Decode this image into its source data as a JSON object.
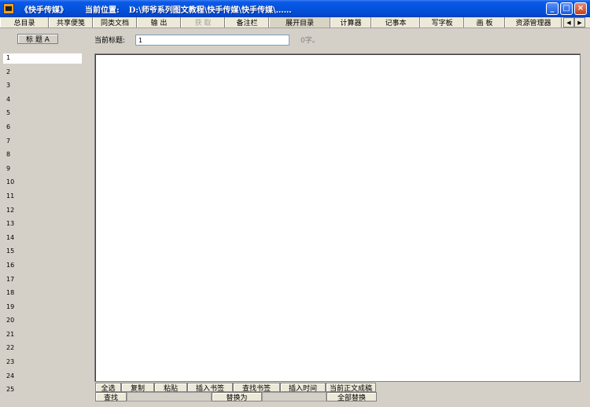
{
  "window": {
    "title": "《快手传媒》",
    "location_label": "当前位置:",
    "location_value": "D:\\师爷系列图文教程\\快手传媒\\快手传媒\\……"
  },
  "window_buttons": {
    "minimize": "_",
    "maximize": "□",
    "close": "×"
  },
  "menu": [
    {
      "label": "总目录",
      "enabled": true
    },
    {
      "label": "共享便笺",
      "enabled": true
    },
    {
      "label": "同类文档",
      "enabled": true
    },
    {
      "label": "输  出",
      "enabled": true
    },
    {
      "label": "获  取",
      "enabled": false
    },
    {
      "label": "备注栏",
      "enabled": true
    },
    {
      "label": "展开目录",
      "enabled": true
    },
    {
      "label": "计算器",
      "enabled": true
    },
    {
      "label": "记事本",
      "enabled": true
    },
    {
      "label": "写字板",
      "enabled": true
    },
    {
      "label": "画  板",
      "enabled": true
    },
    {
      "label": "资源管理器",
      "enabled": true
    }
  ],
  "menu_scroll": {
    "left": "◀",
    "right": "▶"
  },
  "title_list": {
    "header": "标 题 A",
    "items": [
      "1",
      "2",
      "3",
      "4",
      "5",
      "6",
      "7",
      "8",
      "9",
      "10",
      "11",
      "12",
      "13",
      "14",
      "15",
      "16",
      "17",
      "18",
      "19",
      "20",
      "21",
      "22",
      "23",
      "24",
      "25"
    ]
  },
  "current_title": {
    "label": "当前标题:",
    "value": "1",
    "char_count": "0字。"
  },
  "editor": {
    "content": ""
  },
  "toolbar": {
    "select_all": "全选",
    "copy": "复制",
    "paste": "粘贴",
    "insert_bookmark": "插入书签",
    "find_bookmark": "查找书签",
    "insert_time": "插入时间",
    "current_to_draft": "当前正文成稿",
    "find": "查找",
    "replace_with": "替换为",
    "replace_all": "全部替换"
  }
}
